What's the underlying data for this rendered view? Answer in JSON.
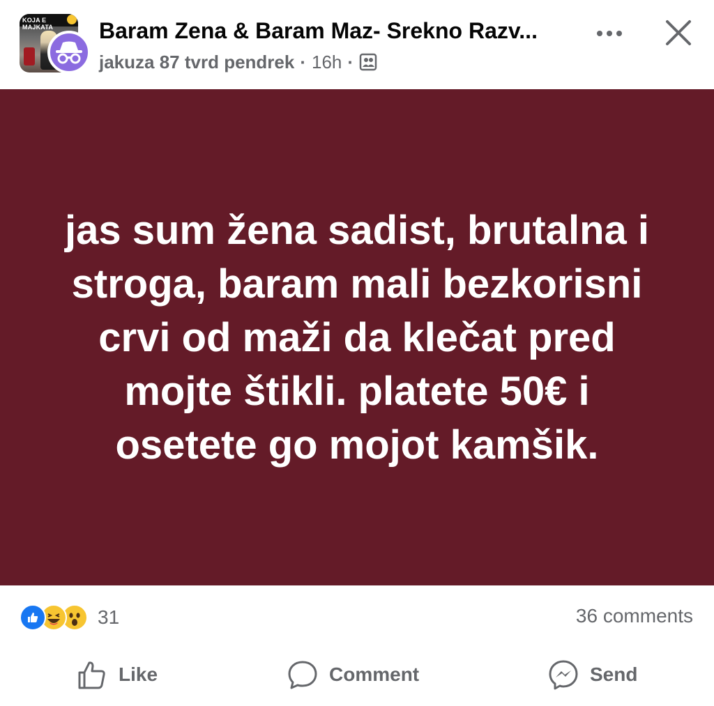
{
  "header": {
    "group_avatar_text": "KOJA E MAJKATA",
    "title": "Baram Zena & Baram Maz- Srekno Razv...",
    "author": "jakuza 87 tvrd pendrek",
    "separator": "·",
    "time": "16h",
    "privacy_icon": "group-members-icon",
    "more_icon": "more-icon",
    "close_icon": "close-icon"
  },
  "post": {
    "background_color": "#641b28",
    "text": "jas sum žena sadist, brutalna i stroga, baram mali bezkorisni crvi od maži da klečat pred mojte štikli. platete 50€ i osetete go mojot kamšik."
  },
  "stats": {
    "reaction_icons": [
      "like-icon",
      "haha-icon",
      "wow-icon"
    ],
    "reaction_count": "31",
    "comments": "36 comments"
  },
  "actions": {
    "like": "Like",
    "comment": "Comment",
    "send": "Send"
  },
  "colors": {
    "like_blue": "#1877f2",
    "secondary_text": "#65676b",
    "emoji_yellow": "#f7c531"
  }
}
